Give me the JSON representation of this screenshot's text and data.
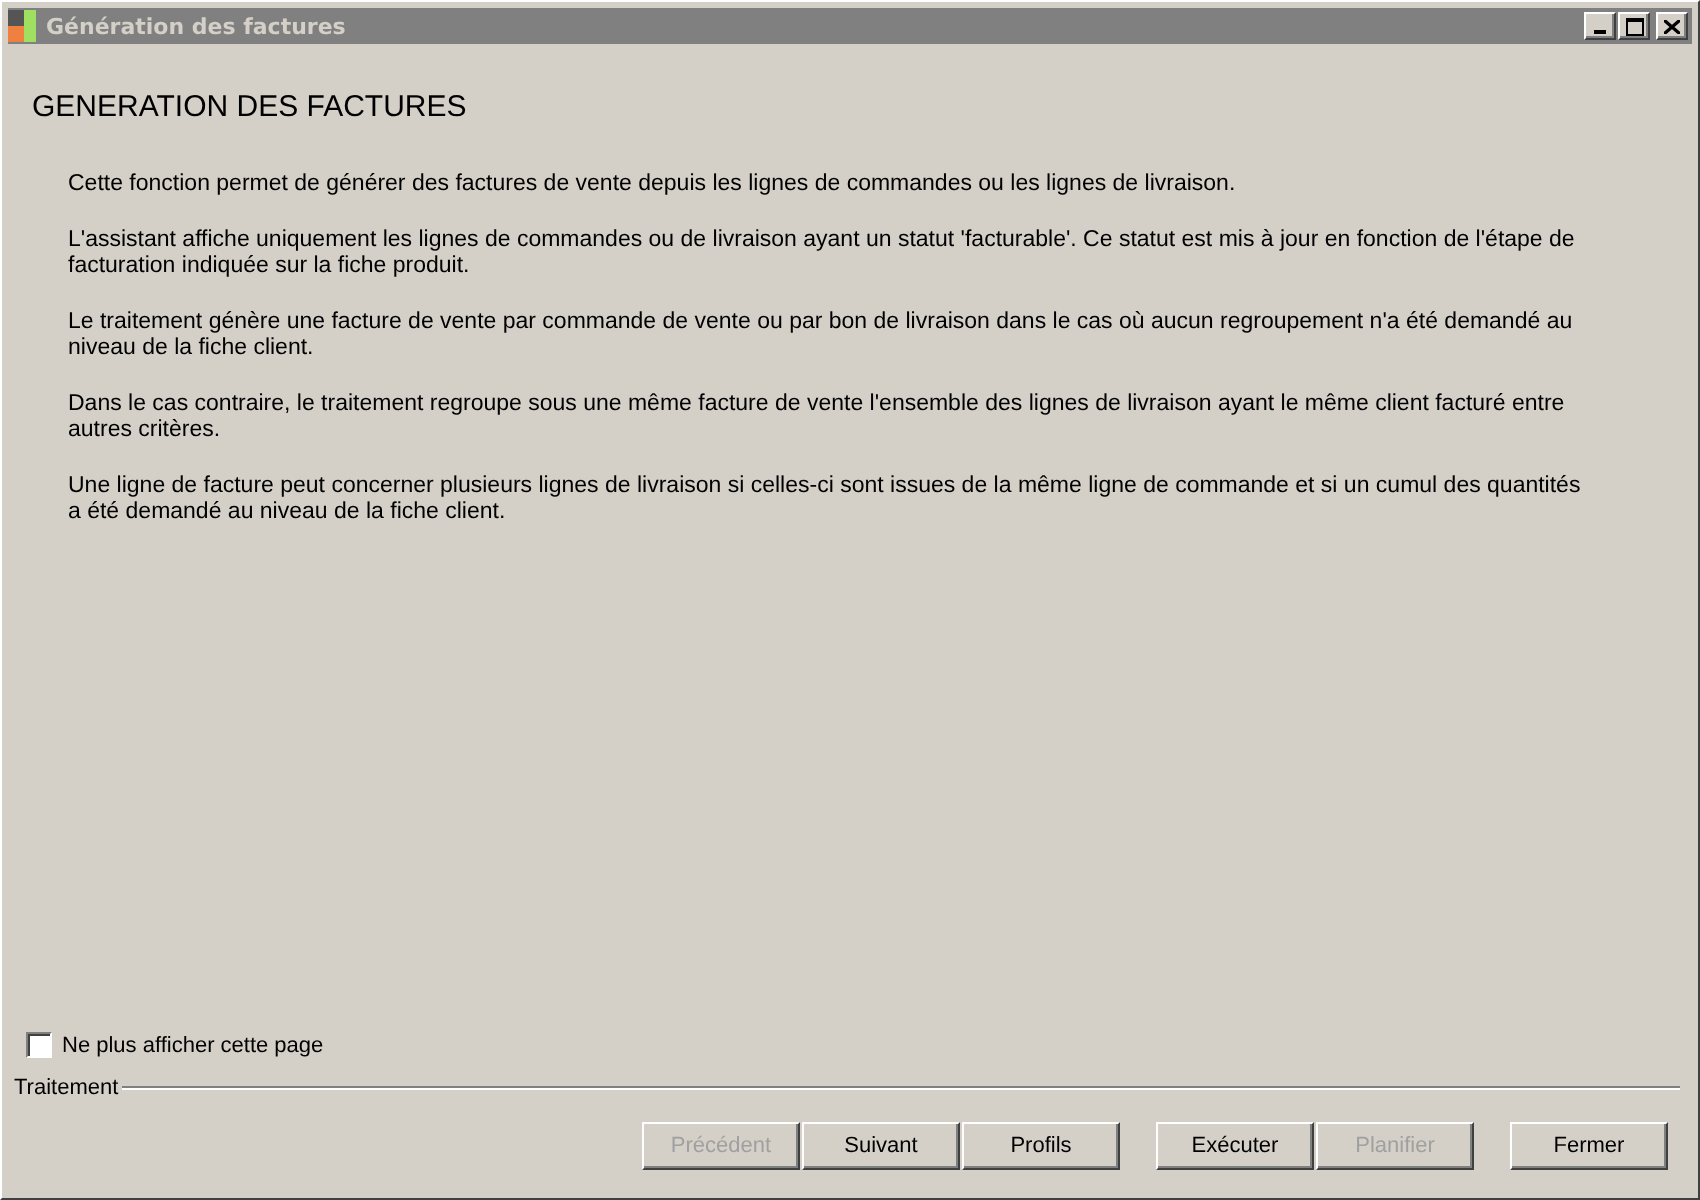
{
  "window": {
    "title": "Génération des factures"
  },
  "heading": "GENERATION DES FACTURES",
  "paragraphs": [
    "Cette fonction permet de générer des factures de vente depuis les lignes de commandes ou les lignes de livraison.",
    "L'assistant affiche uniquement les lignes de commandes ou de livraison ayant un statut 'facturable'. Ce statut est mis à jour en fonction de l'étape de facturation indiquée sur la fiche produit.",
    "Le traitement génère une facture de vente par commande de vente ou par bon de livraison dans le cas où aucun regroupement n'a été demandé au niveau de la fiche client.",
    "Dans le cas contraire, le traitement regroupe sous une même facture de vente l'ensemble des lignes de livraison ayant le même client facturé entre autres critères.",
    "Une ligne de facture peut concerner plusieurs lignes de livraison si celles-ci sont issues de la même ligne de commande et si un cumul des quantités a été demandé au niveau de la fiche client."
  ],
  "checkbox": {
    "label": "Ne plus afficher cette page",
    "checked": false
  },
  "group_label": "Traitement",
  "button_groups": [
    [
      {
        "label": "Précédent",
        "disabled": true
      },
      {
        "label": "Suivant",
        "disabled": false
      },
      {
        "label": "Profils",
        "disabled": false
      }
    ],
    [
      {
        "label": "Exécuter",
        "disabled": false
      },
      {
        "label": "Planifier",
        "disabled": true
      }
    ],
    [
      {
        "label": "Fermer",
        "disabled": false
      }
    ]
  ]
}
